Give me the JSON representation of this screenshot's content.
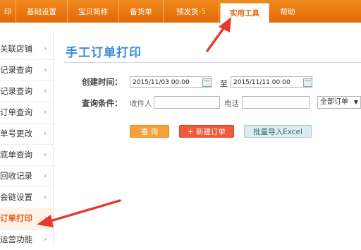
{
  "nav": {
    "tabs": [
      {
        "label": "印"
      },
      {
        "label": "基础设置"
      },
      {
        "label": "宝贝简称"
      },
      {
        "label": "备货单"
      },
      {
        "label": "预发货",
        "badge": "5"
      },
      {
        "label": "实用工具"
      },
      {
        "label": "帮助"
      }
    ],
    "active_tab": "实用工具"
  },
  "sidebar": {
    "items": [
      {
        "label": "关联店铺"
      },
      {
        "label": "记录查询"
      },
      {
        "label": "记录查询"
      },
      {
        "label": "订单查询"
      },
      {
        "label": "单号更改"
      },
      {
        "label": "底单查询"
      },
      {
        "label": "回收记录"
      },
      {
        "label": "会链设置"
      },
      {
        "label": "订单打印"
      },
      {
        "label": "运营功能"
      }
    ],
    "active_item": "订单打印"
  },
  "main": {
    "title": "手工订单打印",
    "create_time_label": "创建时间：",
    "start_date": "2015/11/03 00:00",
    "to_label": "至",
    "end_date": "2015/11/11 00:00",
    "query_label": "查询条件：",
    "recipient_label": "收件人",
    "phone_label": "电话",
    "order_filter": "全部订单",
    "query_button": "查 询",
    "new_order_button": "+ 新建订单",
    "import_button": "批量导入Excel"
  },
  "colors": {
    "nav_bg": "#e8760e",
    "title": "#3c8ad6",
    "arrow": "#e53a2e",
    "active_side": "#e4571b"
  }
}
